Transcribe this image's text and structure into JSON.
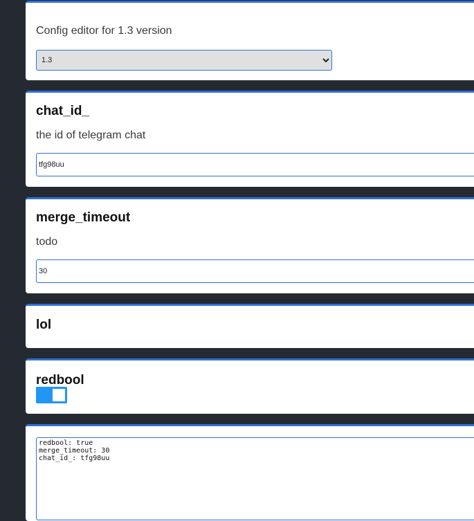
{
  "header": {
    "title": "Config editor for 1.3 version",
    "version_select": {
      "selected": "1.3",
      "options": [
        "1.3"
      ]
    }
  },
  "fields": {
    "chat_id": {
      "name": "chat_id_",
      "description": "the id of telegram chat",
      "value": "tfg98uu"
    },
    "merge_timeout": {
      "name": "merge_timeout",
      "description": "todo",
      "value": "30"
    },
    "lol": {
      "name": "lol"
    },
    "redbool": {
      "name": "redbool",
      "value": true
    }
  },
  "output": {
    "yaml": "redbool: true\nmerge_timeout: 30\nchat_id_: tfg98uu"
  },
  "colors": {
    "page_background": "#252a32",
    "card_accent": "#2f6fd6",
    "toggle_on": "#2196f3"
  }
}
